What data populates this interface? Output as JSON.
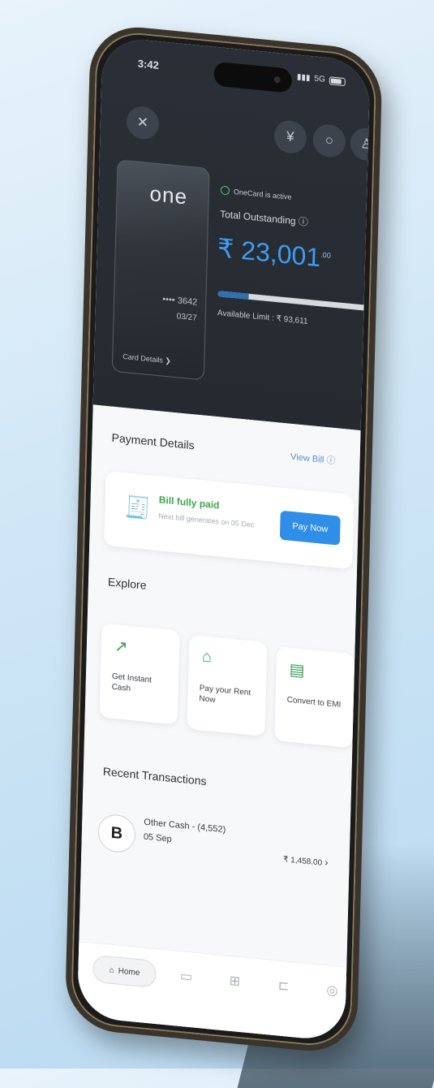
{
  "status_bar": {
    "time": "3:42",
    "signal": "5G"
  },
  "header": {
    "close_icon": "close-icon",
    "icons": [
      "currency-icon",
      "help-icon",
      "user-icon"
    ]
  },
  "card": {
    "logo": "one",
    "number": "•••• 3642",
    "expiry": "03/27",
    "details_link": "Card Details ❯"
  },
  "account": {
    "lock_label": "OneCard is active",
    "outstanding_label": "Total Outstanding ⓘ",
    "outstanding_amount": "₹ 23,001",
    "amount_decimal": ".00",
    "limit_used_fraction": 0.2,
    "available_limit": "Available Limit : ₹ 93,611"
  },
  "payment": {
    "title": "Payment Details",
    "view_bill": "View Bill ⓘ",
    "status": "Bill fully paid",
    "status_sub": "Next bill generates on 05 Dec",
    "pay_button": "Pay Now"
  },
  "explore": {
    "title": "Explore",
    "tiles": [
      {
        "icon": "cash-icon",
        "label": "Get Instant Cash"
      },
      {
        "icon": "bills-icon",
        "label": "Pay your Rent Now"
      },
      {
        "icon": "emi-icon",
        "label": "Convert to EMI"
      }
    ]
  },
  "transactions": {
    "title": "Recent Transactions",
    "items": [
      {
        "icon": "b-logo-icon",
        "name": "Other Cash - (4,552)",
        "date": "05 Sep",
        "amount": "₹ 1,458.00"
      }
    ]
  },
  "bottom_nav": {
    "home_label": "Home",
    "items": [
      "home-icon",
      "card-icon",
      "rewards-icon",
      "offers-icon",
      "profile-icon"
    ]
  },
  "colors": {
    "accent": "#2e8ee8",
    "dark_bg": "#2a2f37",
    "success": "#3da84b"
  }
}
